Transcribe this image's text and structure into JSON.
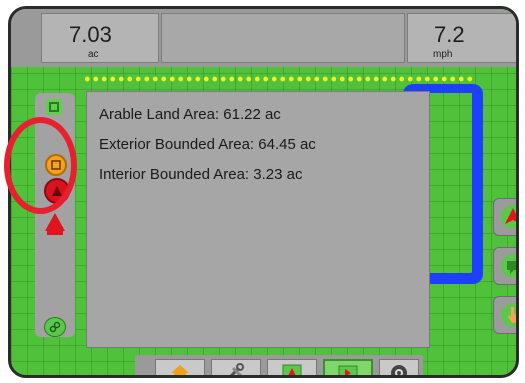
{
  "status": {
    "area_value": "7.03",
    "area_unit": "ac",
    "speed_value": "7.2",
    "speed_unit": "mph"
  },
  "info_panel": {
    "arable_area": "Arable Land Area: 61.22 ac",
    "exterior_area": "Exterior Bounded Area: 64.45 ac",
    "interior_area": "Interior Bounded Area: 3.23 ac"
  },
  "colors": {
    "field": "#4fc13a",
    "boundary": "#1f3fff",
    "highlight": "#e81f2f",
    "active_tab": "#7fd66a"
  },
  "icons": {
    "left_bar": [
      "gps-status-icon",
      "boundary-mark-icon",
      "guidance-lock-icon",
      "vehicle-marker-icon",
      "connection-icon"
    ],
    "right_bar": [
      "guidance-arrow-icon",
      "message-icon",
      "touch-pan-icon"
    ],
    "bottom_bar": [
      "home-icon",
      "tools-icon",
      "guidance-view-icon",
      "field-map-icon",
      "camera-icon"
    ]
  },
  "bottom_bar": {
    "active_index": 3
  }
}
